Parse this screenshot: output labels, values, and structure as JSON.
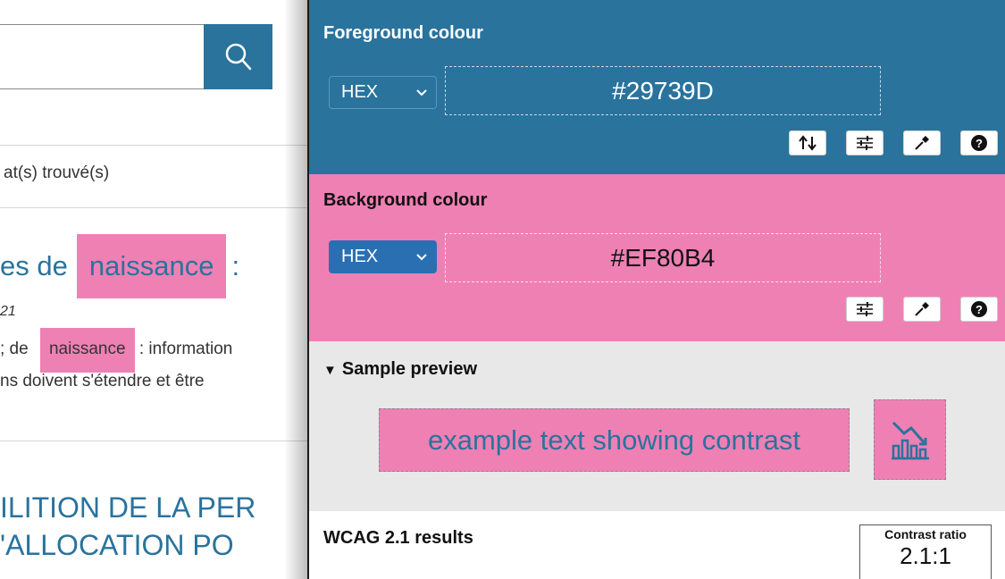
{
  "background_page": {
    "results_text": "at(s) trouvé(s)",
    "result_title_prefix": "es de",
    "result_title_highlight": "naissance",
    "result_title_suffix": ":",
    "result_date": "21",
    "excerpt_prefix": "; de",
    "excerpt_highlight": "naissance",
    "excerpt_suffix": ": information",
    "excerpt_line2": "ns doivent s'étendre et être",
    "heading_line1": "ILITION DE LA PER",
    "heading_line2": "'ALLOCATION PO",
    "search_icon": "search-icon"
  },
  "panel": {
    "foreground": {
      "label": "Foreground colour",
      "format": "HEX",
      "value": "#29739D",
      "color": "#29739D",
      "tools": [
        "swap-icon",
        "sliders-icon",
        "eyedropper-icon",
        "help-icon"
      ]
    },
    "background": {
      "label": "Background colour",
      "format": "HEX",
      "value": "#EF80B4",
      "color": "#EF80B4",
      "tools": [
        "sliders-icon",
        "eyedropper-icon",
        "help-icon"
      ]
    },
    "preview": {
      "toggle": "▼",
      "label": "Sample preview",
      "sample_text": "example text showing contrast",
      "sample_icon": "chart-icon"
    },
    "results": {
      "title": "WCAG 2.1 results",
      "ratio_label": "Contrast ratio",
      "ratio_value": "2.1:1"
    }
  }
}
